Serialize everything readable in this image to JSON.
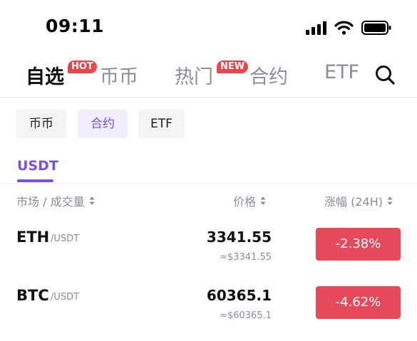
{
  "status_bar": {
    "time": "09:11"
  },
  "main_tabs": [
    {
      "label": "自选",
      "active": true,
      "badge": "HOT"
    },
    {
      "label": "币币",
      "active": false
    },
    {
      "label": "热门",
      "active": false,
      "badge": "NEW"
    },
    {
      "label": "合约",
      "active": false
    },
    {
      "label": "ETF",
      "active": false
    }
  ],
  "chips": [
    {
      "label": "币币",
      "active": false
    },
    {
      "label": "合约",
      "active": true
    },
    {
      "label": "ETF",
      "active": false
    }
  ],
  "sub_tab": {
    "label": "USDT"
  },
  "columns": {
    "market": "市场 / 成交量",
    "price": "价格",
    "change": "涨幅 (24H)"
  },
  "rows": [
    {
      "symbol": "ETH",
      "quote": "/USDT",
      "price": "3341.55",
      "fiat": "≈$3341.55",
      "change": "-2.38%"
    },
    {
      "symbol": "BTC",
      "quote": "/USDT",
      "price": "60365.1",
      "fiat": "≈$60365.1",
      "change": "-4.62%"
    }
  ],
  "colors": {
    "accent": "#7a4fe2",
    "down": "#e5495b",
    "badge": "#e9454b",
    "muted": "#8b8e97"
  }
}
